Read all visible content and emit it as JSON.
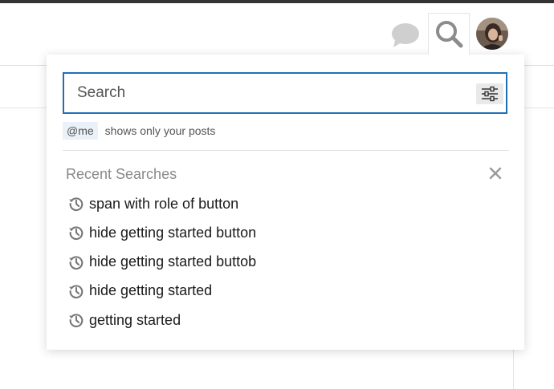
{
  "header": {
    "chat_icon": "chat-bubble-icon",
    "search_icon": "magnifier-icon",
    "avatar": "user-avatar"
  },
  "search": {
    "placeholder": "Search",
    "value": "",
    "filter_icon": "sliders-icon",
    "accent_color": "#1f6fb5"
  },
  "hint": {
    "chip": "@me",
    "text": "shows only your posts"
  },
  "recent": {
    "title": "Recent Searches",
    "clear_icon": "close-icon",
    "item_icon": "history-icon",
    "items": [
      "span with role of button",
      "hide getting started button",
      "hide getting started buttob",
      "hide getting started",
      "getting started"
    ]
  }
}
